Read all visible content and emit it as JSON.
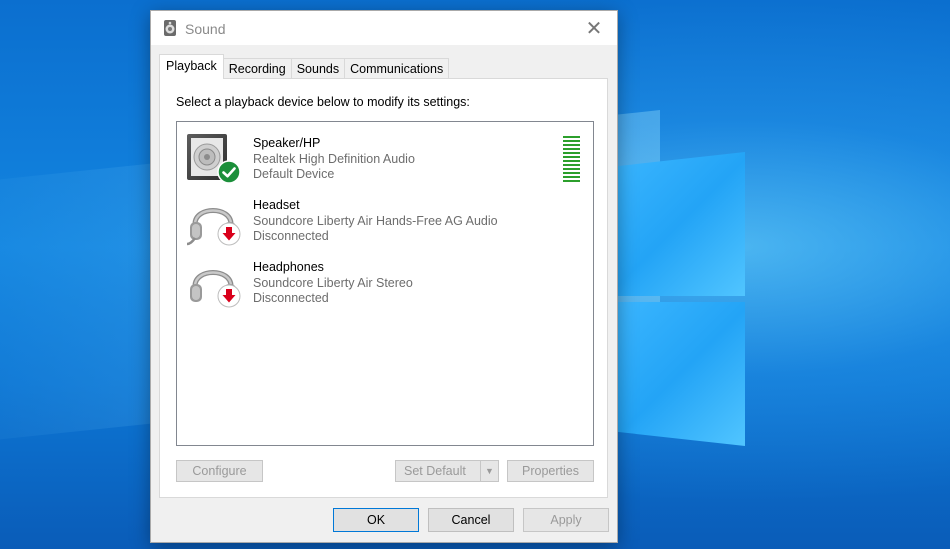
{
  "window": {
    "title": "Sound",
    "close_glyph": "✕"
  },
  "tabs": [
    {
      "label": "Playback",
      "active": true
    },
    {
      "label": "Recording",
      "active": false
    },
    {
      "label": "Sounds",
      "active": false
    },
    {
      "label": "Communications",
      "active": false
    }
  ],
  "playback": {
    "instruction": "Select a playback device below to modify its settings:",
    "devices": [
      {
        "name": "Speaker/HP",
        "driver": "Realtek High Definition Audio",
        "status": "Default Device",
        "icon": "speaker-icon",
        "badge": "default-check-icon"
      },
      {
        "name": "Headset",
        "driver": "Soundcore Liberty Air Hands-Free AG Audio",
        "status": "Disconnected",
        "icon": "headset-icon",
        "badge": "disconnected-arrow-icon"
      },
      {
        "name": "Headphones",
        "driver": "Soundcore Liberty Air Stereo",
        "status": "Disconnected",
        "icon": "headphones-icon",
        "badge": "disconnected-arrow-icon"
      }
    ],
    "level_meter_bars": 10,
    "configure_label": "Configure",
    "set_default_label": "Set Default",
    "properties_label": "Properties"
  },
  "footer": {
    "ok_label": "OK",
    "cancel_label": "Cancel",
    "apply_label": "Apply"
  },
  "colors": {
    "accent": "#0078d7",
    "meter_green": "#2c9f2c",
    "badge_green": "#1b8f3a",
    "badge_red": "#d9001b"
  }
}
